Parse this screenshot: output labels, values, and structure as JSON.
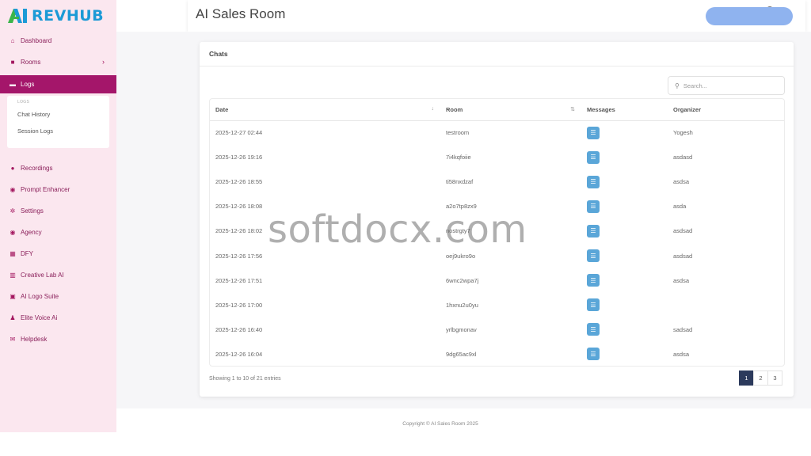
{
  "logo": {
    "text": "REVHUB"
  },
  "sidebar": {
    "items": [
      {
        "icon": "home-icon",
        "glyph": "⌂",
        "label": "Dashboard"
      },
      {
        "icon": "video-icon",
        "glyph": "■",
        "label": "Rooms",
        "chevron": "›"
      },
      {
        "icon": "folder-icon",
        "glyph": "▬",
        "label": "Logs",
        "active": true
      },
      {
        "icon": "record-icon",
        "glyph": "●",
        "label": "Recordings"
      },
      {
        "icon": "palette-icon",
        "glyph": "◉",
        "label": "Prompt Enhancer"
      },
      {
        "icon": "gears-icon",
        "glyph": "✲",
        "label": "Settings"
      },
      {
        "icon": "user-circle-icon",
        "glyph": "◉",
        "label": "Agency"
      },
      {
        "icon": "dfy-icon",
        "glyph": "▦",
        "label": "DFY"
      },
      {
        "icon": "chart-icon",
        "glyph": "▥",
        "label": "Creative Lab AI"
      },
      {
        "icon": "briefcase-icon",
        "glyph": "▣",
        "label": "AI Logo Suite"
      },
      {
        "icon": "users-icon",
        "glyph": "♟",
        "label": "Elite Voice Ai"
      },
      {
        "icon": "envelope-icon",
        "glyph": "✉",
        "label": "Helpdesk"
      }
    ],
    "submenu": {
      "title": "LOGS",
      "items": [
        "Chat History",
        "Session Logs"
      ]
    }
  },
  "header": {
    "title": "AI Sales Room"
  },
  "card": {
    "title": "Chats",
    "search_placeholder": "Search...",
    "columns": [
      "Date",
      "Room",
      "Messages",
      "Organizer"
    ],
    "rows": [
      {
        "date": "2025-12-27 02:44",
        "room": "testroom",
        "organizer": "Yogesh"
      },
      {
        "date": "2025-12-26 19:16",
        "room": "7i4kqfoiie",
        "organizer": "asdasd"
      },
      {
        "date": "2025-12-26 18:55",
        "room": "ti58nxdzaf",
        "organizer": "asdsa"
      },
      {
        "date": "2025-12-26 18:08",
        "room": "a2o7tp8zx9",
        "organizer": "asda"
      },
      {
        "date": "2025-12-26 18:02",
        "room": "nostrgty7",
        "organizer": "asdsad"
      },
      {
        "date": "2025-12-26 17:56",
        "room": "oej9ukro9o",
        "organizer": "asdsad"
      },
      {
        "date": "2025-12-26 17:51",
        "room": "6wnc2wpa7j",
        "organizer": "asdsa"
      },
      {
        "date": "2025-12-26 17:00",
        "room": "1hxnu2u0yu",
        "organizer": ""
      },
      {
        "date": "2025-12-26 16:40",
        "room": "yrlbgmonav",
        "organizer": "sadsad"
      },
      {
        "date": "2025-12-26 16:04",
        "room": "9dg65ac9xl",
        "organizer": "asdsa"
      }
    ],
    "info": "Showing 1 to 10 of 21 entries",
    "pages": [
      "1",
      "2",
      "3"
    ],
    "active_page": "1"
  },
  "footer": {
    "copyright": "Copyright © AI Sales Room 2025"
  },
  "watermark": "softdocx.com",
  "colors": {
    "sidebar_bg": "#fbe7ef",
    "active_nav": "#a4166a",
    "accent_blue": "#1c9ad6",
    "message_icon": "#5aa6d8",
    "page_active": "#2c3a5c"
  }
}
